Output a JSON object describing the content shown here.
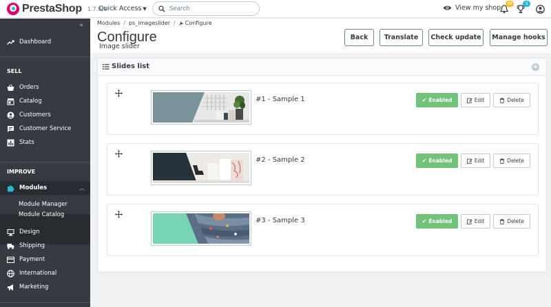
{
  "header": {
    "logo_text": "PrestaShop",
    "version": "1.7.8.8",
    "quick_access_label": "Quick Access",
    "search_placeholder": "Search",
    "view_shop_label": "View my shop",
    "orders_badge": "99",
    "customers_badge": "3"
  },
  "sidebar": {
    "collapse_glyph": "«",
    "dashboard": "Dashboard",
    "sections": {
      "sell": "SELL",
      "improve": "IMPROVE"
    },
    "sell_items": [
      "Orders",
      "Catalog",
      "Customers",
      "Customer Service",
      "Stats"
    ],
    "modules_label": "Modules",
    "modules_sub": [
      "Module Manager",
      "Module Catalog"
    ],
    "improve_items": [
      "Design",
      "Shipping",
      "Payment",
      "International",
      "Marketing"
    ]
  },
  "breadcrumb": {
    "items": [
      "Modules",
      "ps_imageslider",
      "Configure"
    ],
    "separator": "/"
  },
  "page": {
    "title": "Configure",
    "subtitle": "Image slider"
  },
  "toolbar": {
    "back": "Back",
    "translate": "Translate",
    "check_update": "Check update",
    "manage_hooks": "Manage hooks"
  },
  "panel": {
    "title": "Slides list"
  },
  "slides": [
    {
      "name": "#1 - Sample 1",
      "status": "Enabled",
      "edit": "Edit",
      "delete": "Delete"
    },
    {
      "name": "#2 - Sample 2",
      "status": "Enabled",
      "edit": "Edit",
      "delete": "Delete"
    },
    {
      "name": "#3 - Sample 3",
      "status": "Enabled",
      "edit": "Edit",
      "delete": "Delete"
    }
  ],
  "colors": {
    "sidebar_bg": "#363a41",
    "active_accent": "#25b9d7",
    "enabled_green": "#72c279",
    "logo_pink": "#df0067",
    "badge_orange": "#fbbb22",
    "badge_cyan": "#25b9d7"
  },
  "icons": {
    "dashboard": "trending-up-icon",
    "orders": "basket-icon",
    "catalog": "store-icon",
    "customers": "account-circle-icon",
    "customer_service": "chat-icon",
    "stats": "bar-chart-icon",
    "modules": "puzzle-icon",
    "design": "desktop-icon",
    "shipping": "truck-icon",
    "payment": "credit-card-icon",
    "international": "globe-icon",
    "marketing": "megaphone-icon"
  }
}
